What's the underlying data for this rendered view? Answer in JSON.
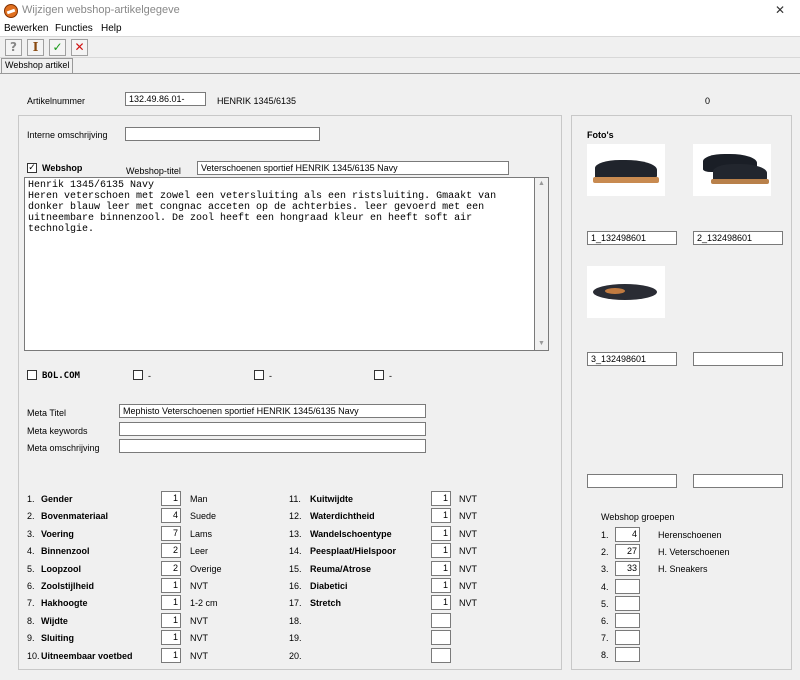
{
  "window": {
    "title": "Wijzigen webshop-artikelgegeve"
  },
  "menu": [
    "Bewerken",
    "Functies",
    "Help"
  ],
  "toolbar": {
    "help": "?",
    "info": "I",
    "ok": "✓",
    "cancel": "✕",
    "colors": {
      "ok": "#1a9a1a",
      "cancel": "#d01010",
      "info": "#8a4a10"
    }
  },
  "tab": {
    "label": "Webshop artikel"
  },
  "article": {
    "nummer_label": "Artikelnummer",
    "nummer": "132.49.86.01-",
    "naam": "HENRIK 1345/6135",
    "count": "0",
    "interne_label": "Interne omschrijving",
    "interne": ""
  },
  "webshop": {
    "label": "Webshop",
    "checked_mark": "✓",
    "titel_label": "Webshop-titel",
    "titel": "Veterschoenen sportief HENRIK 1345/6135 Navy",
    "description": "Henrik 1345/6135 Navy\nHeren veterschoen met zowel een vetersluiting als een ristsluiting. Gmaakt van\ndonker blauw leer met congnac acceten op de achterbies. leer gevoerd met een\nuitneembare binnenzool. De zool heeft een hongraad kleur en heeft soft air\ntechnolgie.",
    "scroll_up": "▲",
    "scroll_down": "▼"
  },
  "channels": [
    {
      "label": "BOL.COM"
    },
    {
      "label": "-"
    },
    {
      "label": "-"
    },
    {
      "label": "-"
    }
  ],
  "meta": {
    "titel_label": "Meta Titel",
    "titel": "Mephisto Veterschoenen sportief HENRIK 1345/6135 Navy",
    "keywords_label": "Meta keywords",
    "keywords": "",
    "omschrijving_label": "Meta omschrijving",
    "omschrijving": ""
  },
  "attributes_left": [
    {
      "num": "1.",
      "name": "Gender",
      "value": "1",
      "text": "Man"
    },
    {
      "num": "2.",
      "name": "Bovenmateriaal",
      "value": "4",
      "text": "Suede"
    },
    {
      "num": "3.",
      "name": "Voering",
      "value": "7",
      "text": "Lams"
    },
    {
      "num": "4.",
      "name": "Binnenzool",
      "value": "2",
      "text": "Leer"
    },
    {
      "num": "5.",
      "name": "Loopzool",
      "value": "2",
      "text": "Overige"
    },
    {
      "num": "6.",
      "name": "Zoolstijlheid",
      "value": "1",
      "text": "NVT"
    },
    {
      "num": "7.",
      "name": "Hakhoogte",
      "value": "1",
      "text": "1-2 cm"
    },
    {
      "num": "8.",
      "name": "Wijdte",
      "value": "1",
      "text": "NVT"
    },
    {
      "num": "9.",
      "name": "Sluiting",
      "value": "1",
      "text": "NVT"
    },
    {
      "num": "10.",
      "name": "Uitneembaar voetbed",
      "value": "1",
      "text": "NVT"
    }
  ],
  "attributes_right": [
    {
      "num": "11.",
      "name": "Kuitwijdte",
      "value": "1",
      "text": "NVT"
    },
    {
      "num": "12.",
      "name": "Waterdichtheid",
      "value": "1",
      "text": "NVT"
    },
    {
      "num": "13.",
      "name": "Wandelschoentype",
      "value": "1",
      "text": "NVT"
    },
    {
      "num": "14.",
      "name": "Peesplaat/Hielspoor",
      "value": "1",
      "text": "NVT"
    },
    {
      "num": "15.",
      "name": "Reuma/Atrose",
      "value": "1",
      "text": "NVT"
    },
    {
      "num": "16.",
      "name": "Diabetici",
      "value": "1",
      "text": "NVT"
    },
    {
      "num": "17.",
      "name": "Stretch",
      "value": "1",
      "text": "NVT"
    },
    {
      "num": "18.",
      "name": "",
      "value": "",
      "text": ""
    },
    {
      "num": "19.",
      "name": "",
      "value": "",
      "text": ""
    },
    {
      "num": "20.",
      "name": "",
      "value": "",
      "text": ""
    }
  ],
  "fotos": {
    "label": "Foto's",
    "names": [
      "1_132498601",
      "2_132498601",
      "3_132498601",
      "",
      "",
      ""
    ]
  },
  "groepen": {
    "label": "Webshop groepen",
    "items": [
      {
        "num": "1.",
        "value": "4",
        "text": "Herenschoenen"
      },
      {
        "num": "2.",
        "value": "27",
        "text": "H. Veterschoenen"
      },
      {
        "num": "3.",
        "value": "33",
        "text": "H. Sneakers"
      },
      {
        "num": "4.",
        "value": "",
        "text": ""
      },
      {
        "num": "5.",
        "value": "",
        "text": ""
      },
      {
        "num": "6.",
        "value": "",
        "text": ""
      },
      {
        "num": "7.",
        "value": "",
        "text": ""
      },
      {
        "num": "8.",
        "value": "",
        "text": ""
      }
    ]
  }
}
